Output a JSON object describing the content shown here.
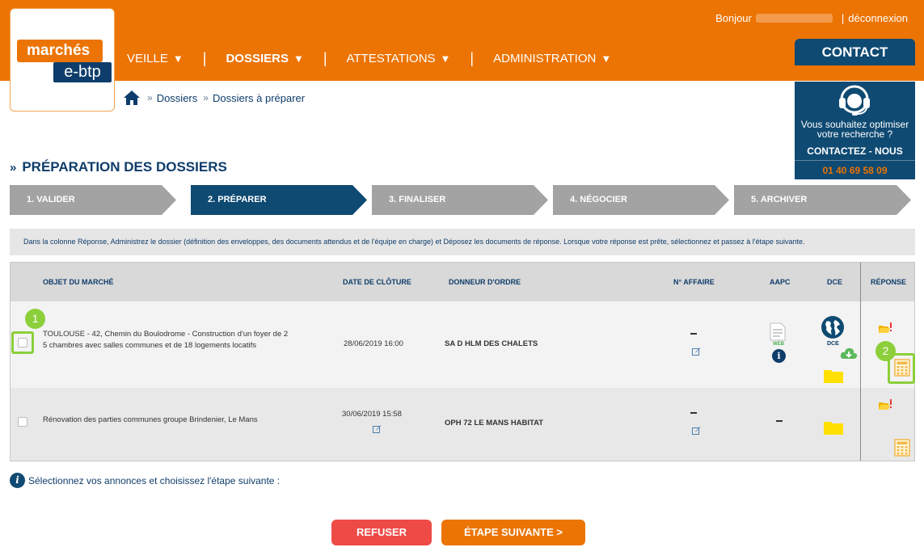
{
  "logo": {
    "top": "marchés",
    "bottom": "e-btp"
  },
  "header": {
    "greeting": "Bonjour",
    "logout": "déconnexion",
    "contact_button": "CONTACT"
  },
  "nav": [
    {
      "label": "VEILLE",
      "active": false
    },
    {
      "label": "DOSSIERS",
      "active": true
    },
    {
      "label": "ATTESTATIONS",
      "active": false
    },
    {
      "label": "ADMINISTRATION",
      "active": false
    }
  ],
  "contact_panel": {
    "question_line1": "Vous souhaitez optimiser",
    "question_line2": "votre recherche ?",
    "cta": "CONTACTEZ - NOUS",
    "phone": "01 40 69 58 09"
  },
  "breadcrumb": [
    "Dossiers",
    "Dossiers à préparer"
  ],
  "page_title": "PRÉPARATION DES DOSSIERS",
  "steps": [
    {
      "label": "1. VALIDER",
      "active": false
    },
    {
      "label": "2. PRÉPARER",
      "active": true
    },
    {
      "label": "3. FINALISER",
      "active": false
    },
    {
      "label": "4. NÉGOCIER",
      "active": false
    },
    {
      "label": "5. ARCHIVER",
      "active": false
    }
  ],
  "info_text": "Dans la colonne Réponse, Administrez le dossier (définition des enveloppes, des documents attendus et de l'équipe en charge) et Déposez les documents de réponse. Lorsque votre réponse est prête, sélectionnez et passez à l'étape suivante.",
  "table": {
    "headers": {
      "objet": "OBJET DU MARCHÉ",
      "date": "DATE DE CLÔTURE",
      "donneur": "DONNEUR D'ORDRE",
      "affaire": "N° AFFAIRE",
      "aapc": "AAPC",
      "dce": "DCE",
      "reponse": "RÉPONSE"
    },
    "rows": [
      {
        "objet_line1": "TOULOUSE - 42, Chemin du Boulodrome - Construction d'un foyer de 2",
        "objet_line2": "5 chambres avec salles communes et de 18 logements locatifs",
        "date": "28/06/2019 16:00",
        "donneur": "SA D HLM DES CHALETS",
        "aapc_label": "WEB",
        "dce_label": "DCE"
      },
      {
        "objet_line1": "Rénovation des parties communes groupe Brindenier, Le Mans",
        "objet_line2": "",
        "date": "30/06/2019 15:58",
        "donneur": "OPH 72 LE MANS HABITAT"
      }
    ]
  },
  "annotations": {
    "badge1": "1",
    "badge2": "2"
  },
  "hint": "Sélectionnez vos annonces et choisissez l'étape suivante :",
  "buttons": {
    "refuse": "REFUSER",
    "next": "ÉTAPE SUIVANTE >"
  },
  "colors": {
    "brand_orange": "#ec7404",
    "navy": "#0f4a72",
    "step_grey": "#a3a3a3",
    "highlight_green": "#8ccf3a",
    "refuse_red": "#ee4b47"
  },
  "icons": [
    "home-icon",
    "headset-icon",
    "info-icon",
    "edit-icon",
    "document-web-icon",
    "globe-icon",
    "cloud-download-icon",
    "folder-icon",
    "calculator-icon",
    "folder-alert-icon"
  ]
}
